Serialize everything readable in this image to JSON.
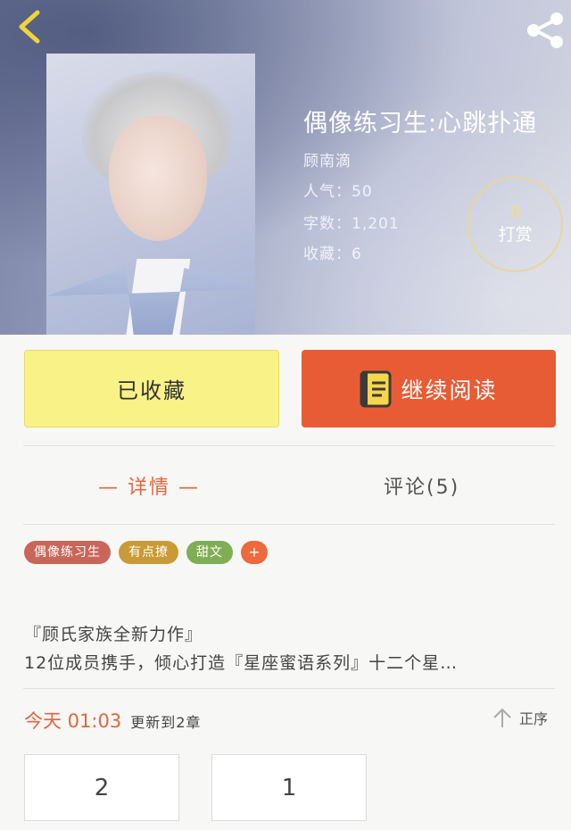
{
  "header": {
    "book_title": "偶像练习生:心跳扑通",
    "author": "顾南滴",
    "popularity": "人气：50",
    "word_count": "字数：1,201",
    "favorites": "收藏：6",
    "reward": {
      "count": "0",
      "label": "打赏"
    }
  },
  "actions": {
    "favorite_label": "已收藏",
    "continue_label": "继续阅读"
  },
  "tabs": {
    "detail": "— 详情 —",
    "comment": "评论(5)"
  },
  "tags": [
    {
      "label": "偶像练习生",
      "color": "#c9665a"
    },
    {
      "label": "有点撩",
      "color": "#c99a36"
    },
    {
      "label": "甜文",
      "color": "#7fae55"
    }
  ],
  "tag_add": "+",
  "description": {
    "line1": "『顾氏家族全新力作』",
    "line2": "12位成员携手，倾心打造『星座蜜语系列』十二个星…"
  },
  "update": {
    "time": "今天 01:03",
    "text": "更新到2章"
  },
  "sort_label": "正序",
  "chapters": [
    "2",
    "1"
  ],
  "colors": {
    "accent": "#e4663e",
    "favorite_button": "#f9f287",
    "continue_button": "#e85c35"
  }
}
